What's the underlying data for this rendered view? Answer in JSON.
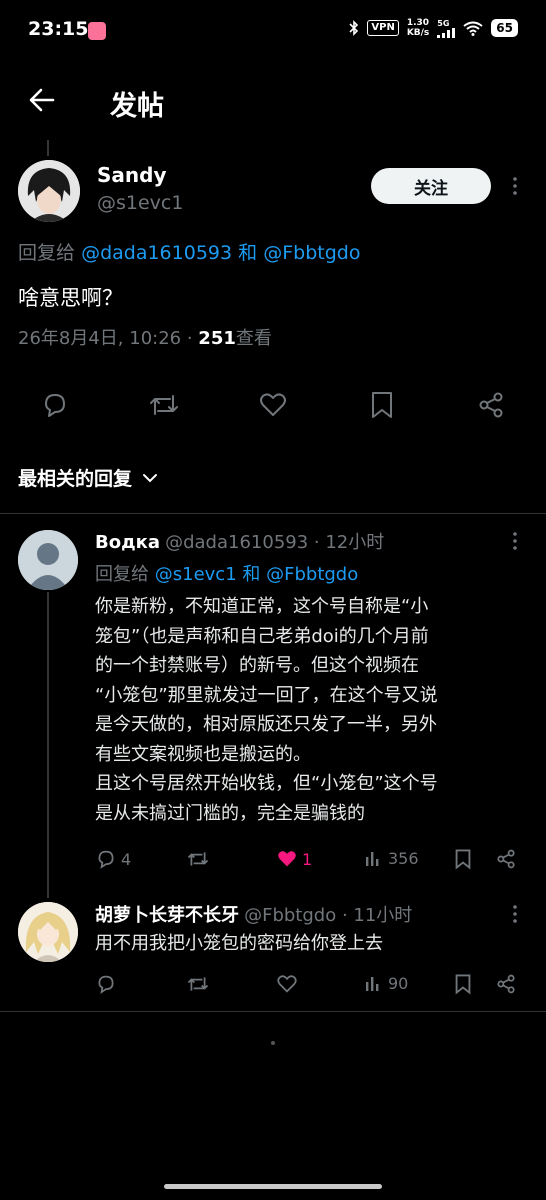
{
  "status": {
    "time": "23:15",
    "vpn": "VPN",
    "speed_value": "1.30",
    "speed_unit": "KB/s",
    "network": "5G",
    "battery": "65"
  },
  "header": {
    "title": "发帖"
  },
  "post": {
    "author_name": "Sandy",
    "author_handle": "@s1evc1",
    "follow_label": "关注",
    "reply_prefix": "回复给",
    "reply_user1": "@dada1610593",
    "reply_and": "和",
    "reply_user2": "@Fbbtgdo",
    "text": "啥意思啊？",
    "date": "26年8月4日, 10:26 · ",
    "views": "251",
    "views_label": "查看"
  },
  "sort": {
    "label": "最相关的回复"
  },
  "replies": [
    {
      "name": "Водка",
      "handle_time": "@dada1610593 · 12小时",
      "reply_prefix": "回复给",
      "reply_user1": "@s1evc1",
      "reply_and": "和",
      "reply_user2": "@Fbbtgdo",
      "lines": [
        "你是新粉，不知道正常，这个号自称是“小",
        "笼包”（也是声称和自己老弟doi的几个月前",
        "的一个封禁账号）的新号。但这个视频在",
        "“小笼包”那里就发过一回了，在这个号又说",
        "是今天做的，相对原版还只发了一半，另外",
        "有些文案视频也是搬运的。",
        "且这个号居然开始收钱，但“小笼包”这个号",
        "是从未搞过门槛的，完全是骗钱的"
      ],
      "replies_count": "4",
      "likes_count": "1",
      "views_count": "356"
    },
    {
      "name": "胡萝卜长芽不长牙",
      "handle_time": "@Fbbtgdo · 11小时",
      "text": "用不用我把小笼包的密码给你登上去",
      "views_count": "90"
    }
  ],
  "colors": {
    "link": "#1d9bf0",
    "like": "#f91880",
    "muted": "#71767b",
    "follow_bg": "#eff3f4"
  },
  "icons": [
    "back-arrow-icon",
    "reply-icon",
    "repost-icon",
    "like-icon",
    "bookmark-icon",
    "share-icon",
    "views-icon",
    "more-icon",
    "chevron-down-icon"
  ]
}
